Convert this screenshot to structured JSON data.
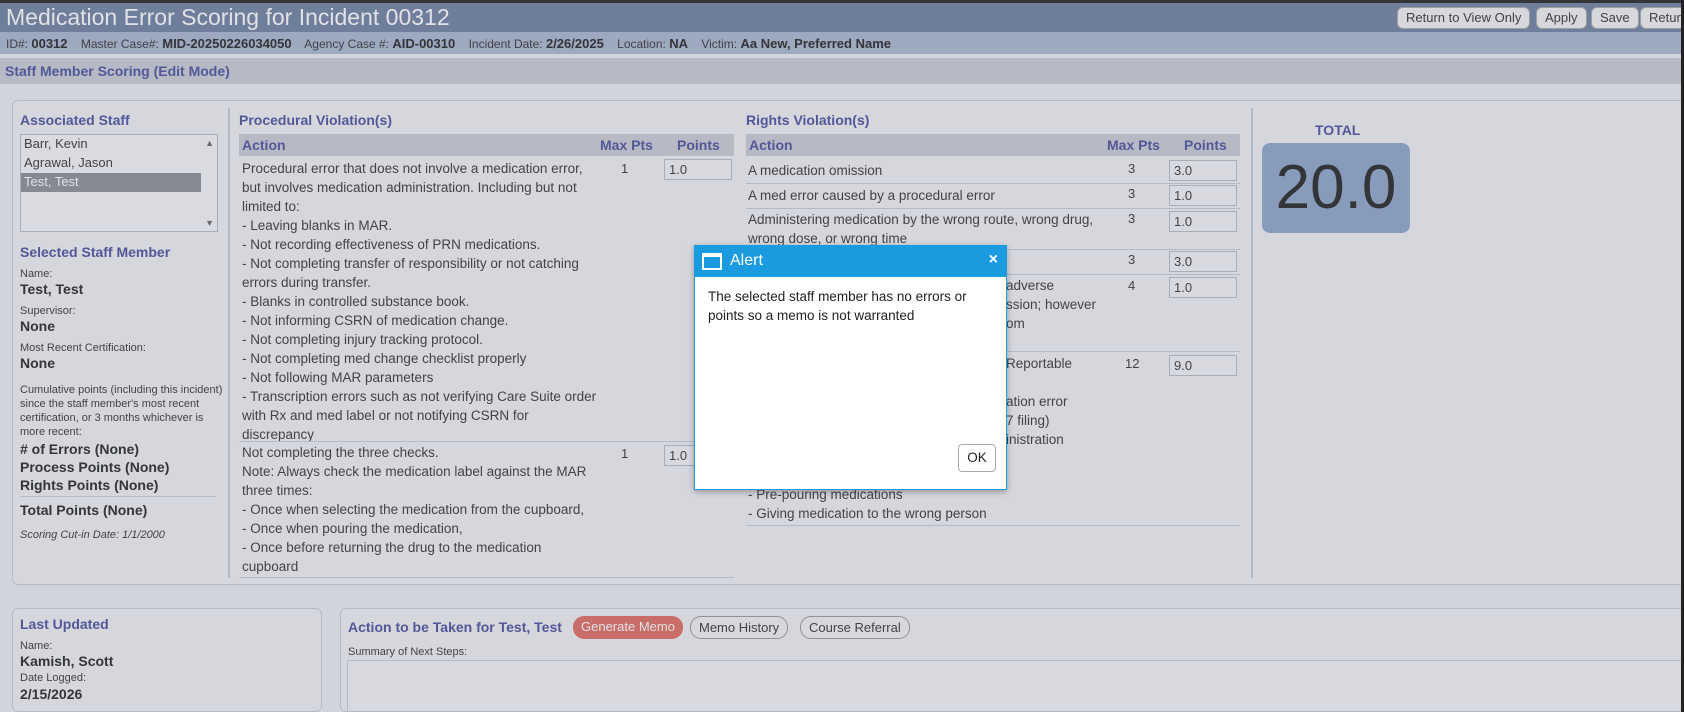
{
  "header": {
    "title": "Medication Error Scoring for Incident 00312",
    "buttons": [
      "Return to View Only",
      "Apply",
      "Save",
      "Return"
    ]
  },
  "infobar": {
    "id_label": "ID#:",
    "id": "00312",
    "master_label": "Master Case#:",
    "master": "MID-20250226034050",
    "agency_label": "Agency Case #:",
    "agency": "AID-00310",
    "date_label": "Incident Date:",
    "date": "2/26/2025",
    "location_label": "Location:",
    "location": "NA",
    "victim_label": "Victim:",
    "victim": "Aa New, Preferred Name"
  },
  "section_title": "Staff Member Scoring (Edit Mode)",
  "associated_staff": {
    "heading": "Associated Staff",
    "items": [
      "Barr, Kevin",
      "Agrawal, Jason",
      "Test, Test"
    ],
    "selected_index": 2
  },
  "selected_staff": {
    "heading": "Selected Staff Member",
    "name_label": "Name:",
    "name": "Test, Test",
    "supervisor_label": "Supervisor:",
    "supervisor": "None",
    "cert_label": "Most Recent Certification:",
    "cert": "None",
    "cumulative_note": "Cumulative points (including this incident) since the staff member's most recent certification, or 3  months whichever is more recent:",
    "errors": "# of Errors (None)",
    "process_points": "Process Points (None)",
    "rights_points": "Rights Points (None)",
    "total_points": "Total Points (None)",
    "cutin": "Scoring Cut-in Date: 1/1/2000"
  },
  "procedural": {
    "heading": "Procedural Violation(s)",
    "col_action": "Action",
    "col_max": "Max Pts",
    "col_points": "Points",
    "rows": [
      {
        "lines": [
          "Procedural error that does not involve a medication error,",
          "but involves medication administration. Including but not",
          "limited to:",
          "- Leaving blanks in MAR.",
          "- Not recording effectiveness of PRN medications.",
          "- Not completing transfer of responsibility or not catching",
          "errors during transfer.",
          "- Blanks in controlled substance book.",
          "- Not informing CSRN of medication change.",
          "- Not completing injury tracking protocol.",
          "- Not completing med change checklist properly",
          "- Not following MAR parameters",
          "- Transcription errors such as not verifying Care Suite order",
          "with Rx and med label or not notifying CSRN for",
          "discrepancy"
        ],
        "max": "1",
        "points": "1.0"
      },
      {
        "lines": [
          "Not completing the three checks.",
          "Note: Always check the medication label against the MAR",
          "three times:",
          "- Once when selecting the medication from the cupboard,",
          "- Once when pouring the medication,",
          "- Once before returning the drug to the medication",
          "cupboard"
        ],
        "max": "1",
        "points": "1.0"
      }
    ]
  },
  "rights": {
    "heading": "Rights Violation(s)",
    "col_action": "Action",
    "col_max": "Max Pts",
    "col_points": "Points",
    "rows": [
      {
        "text": "A medication omission",
        "max": "3",
        "points": "3.0"
      },
      {
        "text": "A med error caused by a procedural error",
        "max": "3",
        "points": "1.0"
      },
      {
        "text": "Administering medication by the wrong route, wrong drug, wrong dose, or wrong time",
        "max": "3",
        "points": "1.0"
      },
      {
        "text": "",
        "max": "3",
        "points": "3.0"
      },
      {
        "text": "adverse",
        "text2": "ssion; however",
        "text3": "om",
        "max": "4",
        "points": "1.0"
      },
      {
        "text": "Reportable",
        "text2": "ation error",
        "text3": "7 filing)",
        "text4": "inistration",
        "text5": "- Pre-pouring medications",
        "text6": "- Giving medication to the wrong person",
        "max": "12",
        "points": "9.0"
      }
    ]
  },
  "total": {
    "label": "TOTAL",
    "value": "20.0"
  },
  "last_updated": {
    "heading": "Last Updated",
    "name_label": "Name:",
    "name": "Kamish, Scott",
    "date_label": "Date Logged:",
    "date": "2/15/2026"
  },
  "action_panel": {
    "heading": "Action to be Taken for Test, Test",
    "generate_memo": "Generate Memo",
    "memo_history": "Memo History",
    "course_referral": "Course Referral",
    "summary_label": "Summary of Next Steps:"
  },
  "dialog": {
    "title": "Alert",
    "close": "×",
    "message": "The selected staff member has no errors or points so a memo is not warranted",
    "ok": "OK"
  },
  "colors": {
    "accent": "#4a4e9c",
    "header": "#6d7f9e",
    "dialog": "#1a9be0",
    "memo": "#e06a5e",
    "total_bg": "#8ea4c8"
  }
}
